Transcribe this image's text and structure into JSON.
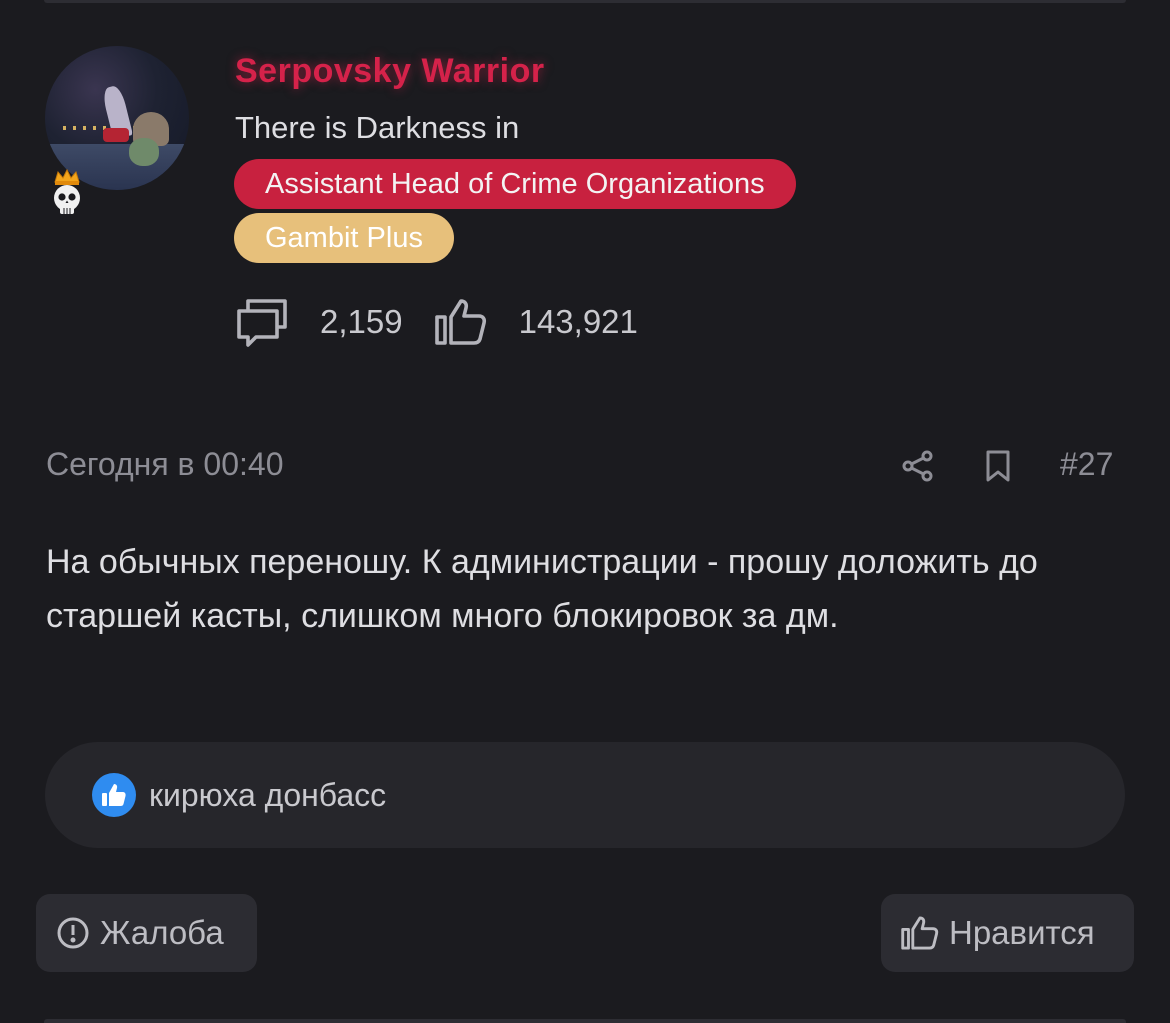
{
  "author": {
    "username": "Serpovsky Warrior",
    "status": "There is Darkness in",
    "role": "Assistant Head of Crime Organizations",
    "plan": "Gambit Plus",
    "messages_count": "2,159",
    "likes_count": "143,921",
    "avatar_icon": "avatar-image",
    "badge_icon": "crowned-skull-icon"
  },
  "post": {
    "date": "Сегодня в 00:40",
    "number": "#27",
    "text": "На обычных переношу. К администрации - прошу доложить до старшей касты, слишком много блокировок за дм."
  },
  "reactions": {
    "icon": "like-icon",
    "users": "кирюха донбасс"
  },
  "actions": {
    "report_label": "Жалоба",
    "like_label": "Нравится"
  },
  "colors": {
    "background": "#1b1b1f",
    "username": "#d5224a",
    "role_tag": "#c8213f",
    "plan_tag": "#e7c07b",
    "like_bubble": "#2f8cf0"
  }
}
